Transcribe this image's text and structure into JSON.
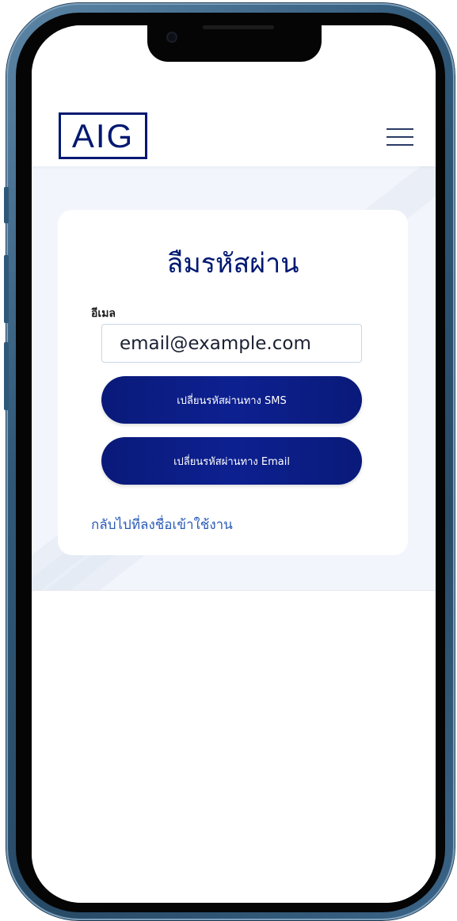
{
  "header": {
    "logo_text": "AIG",
    "menu_icon": "hamburger-menu-icon"
  },
  "form": {
    "title": "ลืมรหัสผ่าน",
    "email_label": "อีเมล",
    "email_value": "email@example.com",
    "sms_button_label": "เปลี่ยนรหัสผ่านทาง SMS",
    "email_button_label": "เปลี่ยนรหัสผ่านทาง Email",
    "back_link_label": "กลับไปที่ลงชื่อเข้าใช้งาน"
  },
  "colors": {
    "brand_navy": "#001871",
    "button_blue": "#0d2090",
    "link_blue": "#2a5bb8",
    "page_background": "#f2f5fb"
  }
}
